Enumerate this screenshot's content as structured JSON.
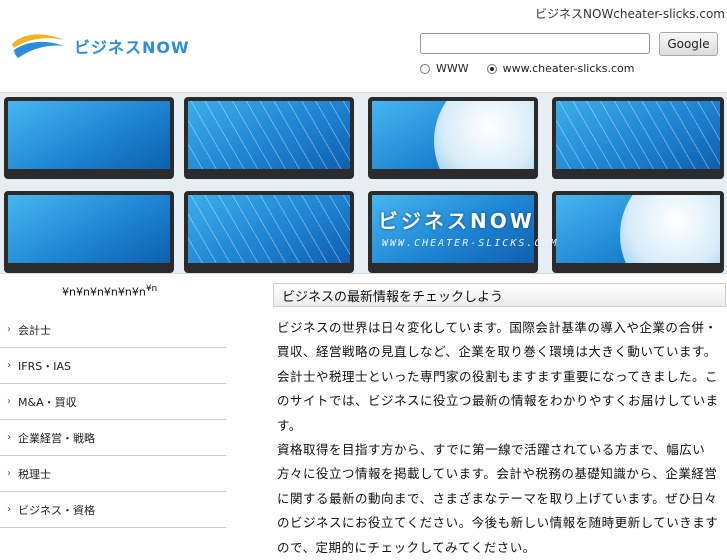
{
  "header": {
    "top_link": "ビジネスNOWcheater-slicks.com",
    "logo_text": "ビジネスNOW",
    "search_placeholder": "",
    "search_button": "Google",
    "radio_options": [
      {
        "label": "WWW",
        "checked": false
      },
      {
        "label": "www.cheater-slicks.com",
        "checked": true
      }
    ]
  },
  "banner": {
    "title": "ビジネスNOW",
    "subtitle": "WWW.CHEATER-SLICKS.COM"
  },
  "sidebar": {
    "heading": "¥n¥n¥n¥n¥n¥n",
    "heading_sup": "¥n",
    "items": [
      {
        "label": "会計士"
      },
      {
        "label": "IFRS・IAS"
      },
      {
        "label": "M&A・買収"
      },
      {
        "label": "企業経営・戦略"
      },
      {
        "label": "税理士"
      },
      {
        "label": "ビジネス・資格"
      }
    ]
  },
  "main": {
    "heading": "ビジネスの最新情報をチェックしよう",
    "paragraphs": [
      "ビジネスの世界は日々変化しています。国際会計基準の導入や企業の合併・買収、経営戦略の見直しなど、企業を取り巻く環境は大きく動いています。会計士や税理士といった専門家の役割もますます重要になってきました。このサイトでは、ビジネスに役立つ最新の情報をわかりやすくお届けしています。",
      "資格取得を目指す方から、すでに第一線で活躍されている方まで、幅広い方々に役立つ情報を掲載しています。会計や税務の基礎知識から、企業経営に関する最新の動向まで、さまざまなテーマを取り上げています。ぜひ日々のビジネスにお役立てください。今後も新しい情報を随時更新していきますので、定期的にチェックしてみてください。"
    ]
  },
  "colors": {
    "accent": "#2a8fd8",
    "banner_bg": "#e7eef3"
  }
}
